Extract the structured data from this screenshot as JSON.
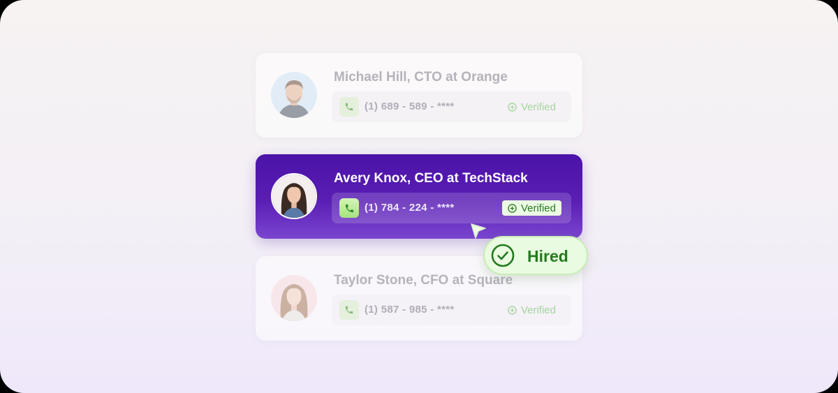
{
  "contacts": [
    {
      "title": "Michael Hill, CTO at Orange",
      "phone": "(1) 689 - 589 - ****",
      "verified_label": "Verified",
      "state": "faded"
    },
    {
      "title": "Avery Knox, CEO at TechStack",
      "phone": "(1) 784 - 224 - ****",
      "verified_label": "Verified",
      "state": "active"
    },
    {
      "title": "Taylor Stone, CFO at Square",
      "phone": "(1) 587 - 985 - ****",
      "verified_label": "Verified",
      "state": "faded"
    }
  ],
  "hired_badge": {
    "label": "Hired"
  },
  "icons": [
    "avatar",
    "phone-icon",
    "plus-circle-icon",
    "cursor-icon",
    "check-circle-icon"
  ],
  "colors": {
    "accent_purple": "#5a1eb4",
    "success_green": "#237a1f",
    "verified_green": "#a4d49c"
  }
}
